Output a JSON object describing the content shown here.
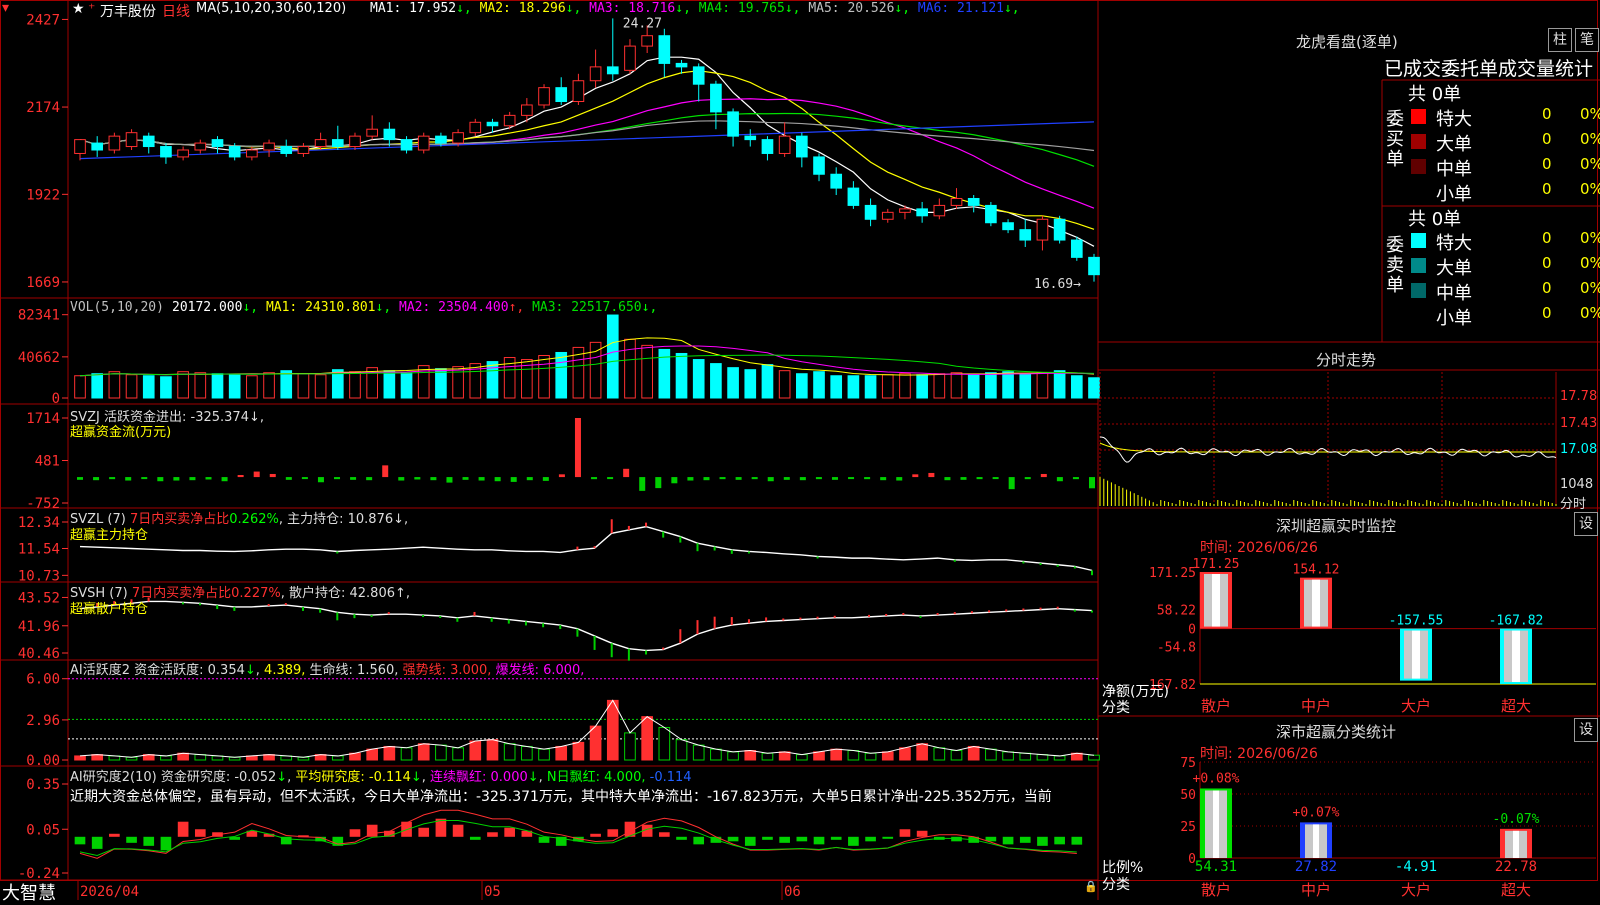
{
  "app": {
    "brand": "大智慧",
    "lock_icon": "lock-icon",
    "star_icon": "star-icon"
  },
  "colors": {
    "up": "#ff3030",
    "down": "#00ffff",
    "grid": "#a00000",
    "ma1": "#ffffff",
    "ma2": "#ffff00",
    "ma3": "#ff00ff",
    "ma4": "#00e000",
    "ma5": "#a0a0a0",
    "ma6": "#2040ff"
  },
  "main_panel": {
    "stock_name": "万丰股份",
    "period": "日线",
    "ma_params": "MA(5,10,20,30,60,120)",
    "ma_items": [
      {
        "label": "MA1: 17.952",
        "arrow": "↓",
        "color": "#ffffff"
      },
      {
        "label": "MA2: 18.296",
        "arrow": "↓",
        "color": "#ffff00"
      },
      {
        "label": "MA3: 18.716",
        "arrow": "↓",
        "color": "#ff00ff"
      },
      {
        "label": "MA4: 19.765",
        "arrow": "↓",
        "color": "#00e000"
      },
      {
        "label": "MA5: 20.526",
        "arrow": "↓",
        "color": "#c0c0c0"
      },
      {
        "label": "MA6: 21.121",
        "arrow": "↓",
        "color": "#2040ff"
      }
    ],
    "y_ticks": [
      "2427",
      "2174",
      "1922",
      "1669"
    ],
    "high_label": "24.27",
    "low_label": "16.69"
  },
  "vol_panel": {
    "params": "VOL(5,10,20)",
    "items": [
      {
        "label": "20172.000",
        "arrow": "↓",
        "color": "#ffffff"
      },
      {
        "label": "MA1: 24310.801",
        "arrow": "↓",
        "color": "#ffff00"
      },
      {
        "label": "MA2: 23504.400",
        "arrow": "↑",
        "color": "#ff00ff"
      },
      {
        "label": "MA3: 22517.650",
        "arrow": "↓",
        "color": "#00e000"
      }
    ],
    "y_ticks": [
      "82341",
      "40662",
      "0"
    ]
  },
  "svzj_panel": {
    "line1": "SVZJ  活跃资金进出: -325.374↓,",
    "line2": "超赢资金流(万元)",
    "y_ticks": [
      "1714",
      "481",
      "-752"
    ]
  },
  "svzl_panel": {
    "prefix": "SVZL (7)",
    "red_text": "7日内买卖净占比",
    "green_val": "0.262%",
    "rest": "主力持仓: 10.876↓,",
    "line2": "超赢主力持仓",
    "y_ticks": [
      "12.34",
      "11.54",
      "10.73"
    ]
  },
  "svsh_panel": {
    "prefix": "SVSH (7)",
    "red_text": "7日内买卖净占比0.227%",
    "rest": "散户持仓: 42.806↑,",
    "line2": "超赢散户持仓",
    "y_ticks": [
      "43.52",
      "41.96",
      "40.46"
    ]
  },
  "ai1_panel": {
    "title": "AI活跃度2",
    "t1": "资金活跃度: 0.354",
    "t1a": "↓",
    "t2": "4.389,",
    "t3": "生命线: 1.560,",
    "t4": "强势线: 3.000,",
    "t5": "爆发线: 6.000,",
    "y_ticks": [
      "6.00",
      "2.96",
      "0.00"
    ]
  },
  "ai2_panel": {
    "title": "AI研究度2(10)",
    "t1": "资金研究度: -0.052",
    "t2": "平均研究度: -0.114",
    "t3": "连续飘红: 0.000",
    "t4": "N日飘红: 4.000,",
    "t5": "-0.114",
    "comment": "近期大资金总体偏空，虽有异动，但不太活跃，今日大单净流出：-325.371万元，其中特大单净流出：-167.823万元，大单5日累计净出-225.352万元，当前",
    "y_ticks": [
      "0.35",
      "0.05",
      "-0.24"
    ]
  },
  "x_axis": {
    "labels": [
      "2026/04",
      "05",
      "06"
    ]
  },
  "right_panel": {
    "buttons": [
      "柱",
      "笔"
    ],
    "lh_title": "龙虎看盘(逐单)",
    "section_title": "已成交委托单成交量统计",
    "buy_label": "委买单",
    "sell_label": "委卖单",
    "buy_total": "共 0单",
    "sell_total": "共 0单",
    "buy_rows": [
      {
        "name": "特大",
        "count": "0",
        "pct": "0%",
        "color": "#ff0000"
      },
      {
        "name": "大单",
        "count": "0",
        "pct": "0%",
        "color": "#a00000"
      },
      {
        "name": "中单",
        "count": "0",
        "pct": "0%",
        "color": "#600000"
      },
      {
        "name": "小单",
        "count": "0",
        "pct": "0%",
        "color": "#000000"
      }
    ],
    "sell_rows": [
      {
        "name": "特大",
        "count": "0",
        "pct": "0%",
        "color": "#00ffff"
      },
      {
        "name": "大单",
        "count": "0",
        "pct": "0%",
        "color": "#008a8a"
      },
      {
        "name": "中单",
        "count": "0",
        "pct": "0%",
        "color": "#006868"
      },
      {
        "name": "小单",
        "count": "0",
        "pct": "0%",
        "color": "#000000"
      }
    ],
    "intraday_title": "分时走势",
    "intraday_y": [
      "17.78",
      "17.43",
      "17.08",
      "1048"
    ],
    "intraday_unit": "分时",
    "monitor_title": "深圳超赢实时监控",
    "set_label": "设",
    "monitor_date": "时间: 2026/06/26",
    "monitor_y": [
      "171.25",
      "58.22",
      "0",
      "-54.8",
      "-167.82"
    ],
    "monitor_axis_label1": "净额(万元)",
    "monitor_axis_label2": "分类",
    "monitor_values": [
      "171.25",
      "154.12",
      "-157.55",
      "-167.82"
    ],
    "categories": [
      "散户",
      "中户",
      "大户",
      "超大"
    ],
    "stats_title": "深市超赢分类统计",
    "stats_date": "时间: 2026/06/26",
    "stats_y": [
      "75",
      "50",
      "25",
      "0"
    ],
    "stats_axis_label1": "比例%",
    "stats_axis_label2": "分类",
    "stats_top": [
      "+0.08%",
      "+0.07%",
      "",
      "-0.07%"
    ],
    "stats_bottom": [
      "54.31",
      "27.82",
      "-4.91",
      "22.78"
    ]
  },
  "chart_data": [
    {
      "type": "candlestick",
      "title": "万丰股份 日线",
      "candles": [
        [
          20.4,
          20.8,
          20.2,
          20.6
        ],
        [
          20.7,
          20.5,
          20.3,
          20.9
        ],
        [
          20.5,
          20.9,
          20.4,
          21.0
        ],
        [
          20.6,
          21.0,
          20.5,
          21.1
        ],
        [
          20.9,
          20.6,
          20.4,
          21.0
        ],
        [
          20.6,
          20.3,
          20.1,
          20.7
        ],
        [
          20.3,
          20.5,
          20.2,
          20.6
        ],
        [
          20.5,
          20.7,
          20.4,
          20.8
        ],
        [
          20.8,
          20.6,
          20.4,
          20.9
        ],
        [
          20.6,
          20.3,
          20.2,
          20.7
        ],
        [
          20.3,
          20.5,
          20.2,
          20.6
        ],
        [
          20.5,
          20.7,
          20.3,
          20.8
        ],
        [
          20.6,
          20.4,
          20.3,
          20.8
        ],
        [
          20.4,
          20.6,
          20.3,
          20.7
        ],
        [
          20.6,
          20.8,
          20.5,
          21.0
        ],
        [
          20.8,
          20.6,
          20.5,
          21.2
        ],
        [
          20.6,
          20.9,
          20.5,
          21.0
        ],
        [
          20.9,
          21.1,
          20.8,
          21.5
        ],
        [
          21.1,
          20.8,
          20.6,
          21.3
        ],
        [
          20.8,
          20.5,
          20.4,
          20.9
        ],
        [
          20.5,
          20.9,
          20.4,
          21.0
        ],
        [
          20.9,
          20.7,
          20.6,
          21.0
        ],
        [
          20.7,
          21.0,
          20.6,
          21.1
        ],
        [
          21.0,
          21.3,
          20.9,
          21.4
        ],
        [
          21.3,
          21.2,
          21.0,
          21.4
        ],
        [
          21.2,
          21.5,
          21.1,
          21.6
        ],
        [
          21.5,
          21.8,
          21.3,
          22.0
        ],
        [
          21.8,
          22.3,
          21.7,
          22.4
        ],
        [
          22.3,
          21.9,
          21.8,
          22.6
        ],
        [
          21.9,
          22.5,
          21.8,
          22.7
        ],
        [
          22.5,
          22.9,
          22.3,
          23.4
        ],
        [
          22.9,
          22.7,
          22.5,
          24.3
        ],
        [
          22.8,
          23.5,
          22.7,
          23.7
        ],
        [
          23.5,
          23.8,
          23.3,
          24.1
        ],
        [
          23.8,
          23.0,
          22.6,
          24.0
        ],
        [
          23.0,
          22.9,
          22.7,
          23.1
        ],
        [
          22.9,
          22.4,
          21.9,
          23.0
        ],
        [
          22.4,
          21.6,
          21.1,
          22.5
        ],
        [
          21.6,
          20.9,
          20.6,
          21.7
        ],
        [
          20.9,
          20.8,
          20.6,
          21.1
        ],
        [
          20.8,
          20.4,
          20.2,
          20.9
        ],
        [
          20.4,
          20.9,
          20.3,
          21.3
        ],
        [
          20.9,
          20.3,
          20.0,
          21.0
        ],
        [
          20.3,
          19.8,
          19.6,
          20.4
        ],
        [
          19.8,
          19.4,
          19.2,
          20.0
        ],
        [
          19.4,
          18.9,
          18.8,
          19.6
        ],
        [
          18.9,
          18.5,
          18.3,
          19.1
        ],
        [
          18.5,
          18.7,
          18.4,
          18.8
        ],
        [
          18.7,
          18.8,
          18.5,
          18.9
        ],
        [
          18.8,
          18.6,
          18.4,
          19.0
        ],
        [
          18.6,
          18.9,
          18.5,
          19.1
        ],
        [
          18.9,
          19.1,
          18.8,
          19.4
        ],
        [
          19.1,
          18.9,
          18.7,
          19.2
        ],
        [
          18.9,
          18.4,
          18.3,
          19.0
        ],
        [
          18.4,
          18.2,
          18.1,
          18.5
        ],
        [
          18.2,
          17.9,
          17.7,
          18.5
        ],
        [
          17.9,
          18.5,
          17.6,
          18.6
        ],
        [
          18.5,
          17.9,
          17.8,
          18.6
        ],
        [
          17.9,
          17.4,
          17.3,
          18.0
        ],
        [
          17.4,
          16.9,
          16.7,
          17.5
        ]
      ]
    },
    {
      "type": "bar",
      "title": "VOL(5,10,20)",
      "values": [
        22,
        24,
        26,
        23,
        22,
        21,
        26,
        25,
        24,
        23,
        22,
        25,
        27,
        24,
        23,
        28,
        26,
        30,
        27,
        25,
        32,
        29,
        31,
        34,
        36,
        40,
        38,
        42,
        45,
        50,
        55,
        82,
        58,
        52,
        48,
        44,
        38,
        34,
        30,
        28,
        33,
        27,
        24,
        26,
        22,
        22,
        22,
        23,
        24,
        23,
        24,
        25,
        23,
        25,
        26,
        24,
        25,
        27,
        22,
        20
      ]
    },
    {
      "type": "bar",
      "title": "SVZJ",
      "values": [
        -80,
        -90,
        -60,
        -100,
        -50,
        -120,
        -100,
        -90,
        -70,
        -120,
        60,
        160,
        90,
        -80,
        -50,
        -150,
        -60,
        -80,
        -90,
        340,
        -100,
        -70,
        -90,
        -160,
        -80,
        -100,
        -120,
        -140,
        -90,
        -110,
        80,
        1714,
        -60,
        -50,
        240,
        -400,
        -320,
        -180,
        -100,
        -90,
        -60,
        -80,
        -60,
        -120,
        -80,
        -90,
        -60,
        -80,
        -40,
        -60,
        -90,
        -100,
        80,
        120,
        -90,
        -80,
        -60,
        -40,
        -350,
        -60,
        90,
        -120,
        -60,
        -325
      ]
    },
    {
      "type": "line",
      "title": "SVZL",
      "values": [
        11.6,
        11.58,
        11.56,
        11.54,
        11.52,
        11.5,
        11.48,
        11.48,
        11.46,
        11.45,
        11.47,
        11.5,
        11.52,
        11.52,
        11.5,
        11.45,
        11.48,
        11.5,
        11.52,
        11.55,
        11.58,
        11.55,
        11.52,
        11.5,
        11.5,
        11.47,
        11.45,
        11.45,
        11.42,
        11.5,
        11.55,
        12.0,
        12.1,
        12.2,
        12.05,
        11.9,
        11.7,
        11.6,
        11.5,
        11.45,
        11.42,
        11.38,
        11.35,
        11.3,
        11.28,
        11.25,
        11.25,
        11.22,
        11.2,
        11.22,
        11.25,
        11.2,
        11.18,
        11.2,
        11.2,
        11.15,
        11.1,
        11.05,
        11.0,
        10.88
      ]
    },
    {
      "type": "line",
      "title": "SVSH",
      "values": [
        42.9,
        43.0,
        43.1,
        43.2,
        43.3,
        43.3,
        43.25,
        43.2,
        43.1,
        43.0,
        43.0,
        43.05,
        43.1,
        43.0,
        42.9,
        42.7,
        42.6,
        42.55,
        42.6,
        42.6,
        42.55,
        42.5,
        42.4,
        42.5,
        42.4,
        42.3,
        42.2,
        42.1,
        42.0,
        41.8,
        41.4,
        41.0,
        40.7,
        40.6,
        40.65,
        41.0,
        41.5,
        41.8,
        42.0,
        42.1,
        42.2,
        42.25,
        42.3,
        42.35,
        42.4,
        42.4,
        42.45,
        42.5,
        42.55,
        42.5,
        42.55,
        42.6,
        42.65,
        42.7,
        42.75,
        42.8,
        42.85,
        42.9,
        42.85,
        42.8
      ]
    },
    {
      "type": "bar",
      "title": "AI活跃度2",
      "values": [
        0.3,
        0.4,
        0.3,
        0.2,
        0.4,
        0.3,
        0.5,
        0.4,
        0.3,
        0.2,
        0.3,
        0.4,
        0.3,
        0.2,
        0.4,
        0.3,
        0.5,
        0.8,
        1.0,
        0.9,
        1.2,
        1.1,
        0.9,
        1.4,
        1.5,
        1.2,
        1.0,
        0.8,
        1.0,
        1.3,
        2.5,
        4.4,
        2.0,
        3.2,
        2.4,
        1.5,
        1.1,
        0.8,
        0.6,
        0.7,
        0.5,
        0.6,
        0.4,
        0.6,
        0.8,
        0.7,
        0.5,
        0.6,
        0.9,
        1.2,
        0.9,
        0.7,
        1.0,
        0.8,
        0.6,
        0.5,
        0.4,
        0.3,
        0.5,
        0.354
      ]
    },
    {
      "type": "bar",
      "title": "AI研究度2(10)",
      "values": [
        -0.05,
        -0.08,
        0.02,
        -0.04,
        -0.06,
        -0.09,
        0.1,
        0.05,
        0.03,
        -0.02,
        0.04,
        0.02,
        -0.05,
        0.01,
        -0.03,
        -0.06,
        0.05,
        0.08,
        0.04,
        0.1,
        0.06,
        0.12,
        0.08,
        -0.02,
        0.03,
        0.06,
        0.04,
        -0.04,
        -0.06,
        -0.03,
        0.02,
        0.05,
        0.1,
        0.08,
        0.03,
        -0.02,
        -0.05,
        -0.04,
        -0.03,
        -0.06,
        -0.02,
        -0.04,
        -0.03,
        -0.05,
        -0.02,
        -0.06,
        -0.03,
        -0.01,
        0.05,
        0.04,
        -0.02,
        -0.03,
        -0.04,
        -0.03,
        -0.05,
        -0.04,
        -0.06,
        -0.05,
        -0.052
      ]
    }
  ]
}
